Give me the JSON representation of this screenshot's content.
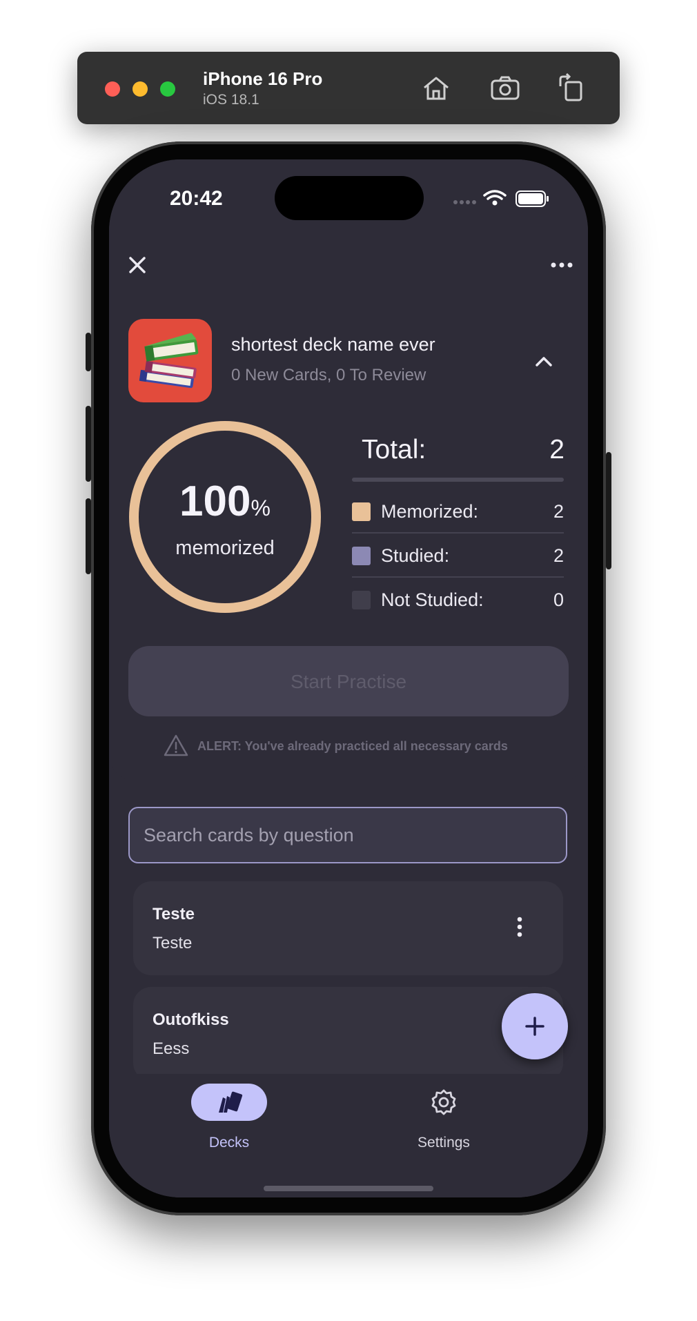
{
  "simulator": {
    "device_name": "iPhone 16 Pro",
    "os_version": "iOS 18.1",
    "toolbar_icons": [
      "home-icon",
      "screenshot-icon",
      "rotate-icon"
    ]
  },
  "status_bar": {
    "time": "20:42",
    "icons": [
      "signal-icon",
      "wifi-icon",
      "battery-icon"
    ]
  },
  "header": {
    "close_icon": "close-icon",
    "more_icon": "more-horizontal-icon"
  },
  "deck": {
    "title": "shortest deck name ever",
    "subtitle": "0 New Cards, 0 To Review",
    "icon": "books-icon",
    "icon_bg": "#e24b3c"
  },
  "progress": {
    "percent_number": "100",
    "percent_symbol": "%",
    "label": "memorized",
    "fraction": 1.0,
    "ring_color": "#e9c198"
  },
  "stats": {
    "total_label": "Total:",
    "total_value": "2",
    "rows": [
      {
        "label": "Memorized:",
        "value": "2",
        "color": "#e9c198"
      },
      {
        "label": "Studied:",
        "value": "2",
        "color": "#8c89b4"
      },
      {
        "label": "Not Studied:",
        "value": "0",
        "color": "#403e4b"
      }
    ]
  },
  "actions": {
    "start_label": "Start Practise",
    "alert_text": "ALERT: You've already practiced all necessary cards"
  },
  "search": {
    "placeholder": "Search cards by question"
  },
  "cards": [
    {
      "question": "Teste",
      "answer": "Teste"
    },
    {
      "question": "Outofkiss",
      "answer": "Eess"
    }
  ],
  "nav": {
    "items": [
      {
        "label": "Decks",
        "icon": "cards-icon",
        "active": true
      },
      {
        "label": "Settings",
        "icon": "gear-icon",
        "active": false
      }
    ]
  },
  "colors": {
    "accent": "#c4c3fa",
    "background": "#2e2c38",
    "card": "#35333f"
  }
}
